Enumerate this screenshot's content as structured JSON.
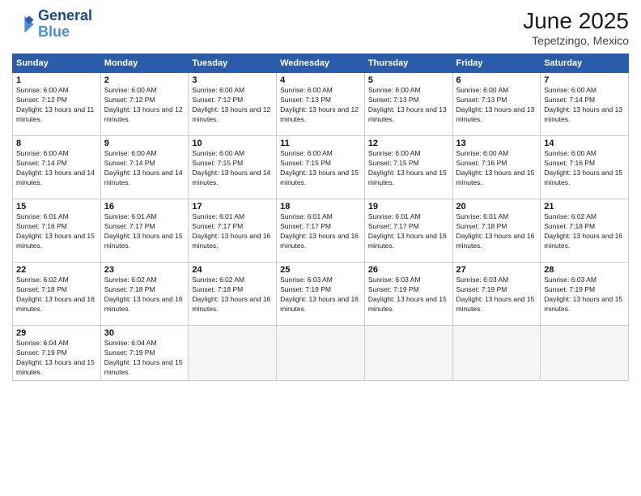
{
  "header": {
    "logo_line1": "General",
    "logo_line2": "Blue",
    "month_title": "June 2025",
    "location": "Tepetzingo, Mexico"
  },
  "weekdays": [
    "Sunday",
    "Monday",
    "Tuesday",
    "Wednesday",
    "Thursday",
    "Friday",
    "Saturday"
  ],
  "weeks": [
    [
      {
        "day": "1",
        "sunrise": "Sunrise: 6:00 AM",
        "sunset": "Sunset: 7:12 PM",
        "daylight": "Daylight: 13 hours and 11 minutes."
      },
      {
        "day": "2",
        "sunrise": "Sunrise: 6:00 AM",
        "sunset": "Sunset: 7:12 PM",
        "daylight": "Daylight: 13 hours and 12 minutes."
      },
      {
        "day": "3",
        "sunrise": "Sunrise: 6:00 AM",
        "sunset": "Sunset: 7:12 PM",
        "daylight": "Daylight: 13 hours and 12 minutes."
      },
      {
        "day": "4",
        "sunrise": "Sunrise: 6:00 AM",
        "sunset": "Sunset: 7:13 PM",
        "daylight": "Daylight: 13 hours and 12 minutes."
      },
      {
        "day": "5",
        "sunrise": "Sunrise: 6:00 AM",
        "sunset": "Sunset: 7:13 PM",
        "daylight": "Daylight: 13 hours and 13 minutes."
      },
      {
        "day": "6",
        "sunrise": "Sunrise: 6:00 AM",
        "sunset": "Sunset: 7:13 PM",
        "daylight": "Daylight: 13 hours and 13 minutes."
      },
      {
        "day": "7",
        "sunrise": "Sunrise: 6:00 AM",
        "sunset": "Sunset: 7:14 PM",
        "daylight": "Daylight: 13 hours and 13 minutes."
      }
    ],
    [
      {
        "day": "8",
        "sunrise": "Sunrise: 6:00 AM",
        "sunset": "Sunset: 7:14 PM",
        "daylight": "Daylight: 13 hours and 14 minutes."
      },
      {
        "day": "9",
        "sunrise": "Sunrise: 6:00 AM",
        "sunset": "Sunset: 7:14 PM",
        "daylight": "Daylight: 13 hours and 14 minutes."
      },
      {
        "day": "10",
        "sunrise": "Sunrise: 6:00 AM",
        "sunset": "Sunset: 7:15 PM",
        "daylight": "Daylight: 13 hours and 14 minutes."
      },
      {
        "day": "11",
        "sunrise": "Sunrise: 6:00 AM",
        "sunset": "Sunset: 7:15 PM",
        "daylight": "Daylight: 13 hours and 15 minutes."
      },
      {
        "day": "12",
        "sunrise": "Sunrise: 6:00 AM",
        "sunset": "Sunset: 7:15 PM",
        "daylight": "Daylight: 13 hours and 15 minutes."
      },
      {
        "day": "13",
        "sunrise": "Sunrise: 6:00 AM",
        "sunset": "Sunset: 7:16 PM",
        "daylight": "Daylight: 13 hours and 15 minutes."
      },
      {
        "day": "14",
        "sunrise": "Sunrise: 6:00 AM",
        "sunset": "Sunset: 7:16 PM",
        "daylight": "Daylight: 13 hours and 15 minutes."
      }
    ],
    [
      {
        "day": "15",
        "sunrise": "Sunrise: 6:01 AM",
        "sunset": "Sunset: 7:16 PM",
        "daylight": "Daylight: 13 hours and 15 minutes."
      },
      {
        "day": "16",
        "sunrise": "Sunrise: 6:01 AM",
        "sunset": "Sunset: 7:17 PM",
        "daylight": "Daylight: 13 hours and 15 minutes."
      },
      {
        "day": "17",
        "sunrise": "Sunrise: 6:01 AM",
        "sunset": "Sunset: 7:17 PM",
        "daylight": "Daylight: 13 hours and 16 minutes."
      },
      {
        "day": "18",
        "sunrise": "Sunrise: 6:01 AM",
        "sunset": "Sunset: 7:17 PM",
        "daylight": "Daylight: 13 hours and 16 minutes."
      },
      {
        "day": "19",
        "sunrise": "Sunrise: 6:01 AM",
        "sunset": "Sunset: 7:17 PM",
        "daylight": "Daylight: 13 hours and 16 minutes."
      },
      {
        "day": "20",
        "sunrise": "Sunrise: 6:01 AM",
        "sunset": "Sunset: 7:18 PM",
        "daylight": "Daylight: 13 hours and 16 minutes."
      },
      {
        "day": "21",
        "sunrise": "Sunrise: 6:02 AM",
        "sunset": "Sunset: 7:18 PM",
        "daylight": "Daylight: 13 hours and 16 minutes."
      }
    ],
    [
      {
        "day": "22",
        "sunrise": "Sunrise: 6:02 AM",
        "sunset": "Sunset: 7:18 PM",
        "daylight": "Daylight: 13 hours and 16 minutes."
      },
      {
        "day": "23",
        "sunrise": "Sunrise: 6:02 AM",
        "sunset": "Sunset: 7:18 PM",
        "daylight": "Daylight: 13 hours and 16 minutes."
      },
      {
        "day": "24",
        "sunrise": "Sunrise: 6:02 AM",
        "sunset": "Sunset: 7:18 PM",
        "daylight": "Daylight: 13 hours and 16 minutes."
      },
      {
        "day": "25",
        "sunrise": "Sunrise: 6:03 AM",
        "sunset": "Sunset: 7:19 PM",
        "daylight": "Daylight: 13 hours and 16 minutes."
      },
      {
        "day": "26",
        "sunrise": "Sunrise: 6:03 AM",
        "sunset": "Sunset: 7:19 PM",
        "daylight": "Daylight: 13 hours and 15 minutes."
      },
      {
        "day": "27",
        "sunrise": "Sunrise: 6:03 AM",
        "sunset": "Sunset: 7:19 PM",
        "daylight": "Daylight: 13 hours and 15 minutes."
      },
      {
        "day": "28",
        "sunrise": "Sunrise: 6:03 AM",
        "sunset": "Sunset: 7:19 PM",
        "daylight": "Daylight: 13 hours and 15 minutes."
      }
    ],
    [
      {
        "day": "29",
        "sunrise": "Sunrise: 6:04 AM",
        "sunset": "Sunset: 7:19 PM",
        "daylight": "Daylight: 13 hours and 15 minutes."
      },
      {
        "day": "30",
        "sunrise": "Sunrise: 6:04 AM",
        "sunset": "Sunset: 7:19 PM",
        "daylight": "Daylight: 13 hours and 15 minutes."
      },
      null,
      null,
      null,
      null,
      null
    ]
  ]
}
